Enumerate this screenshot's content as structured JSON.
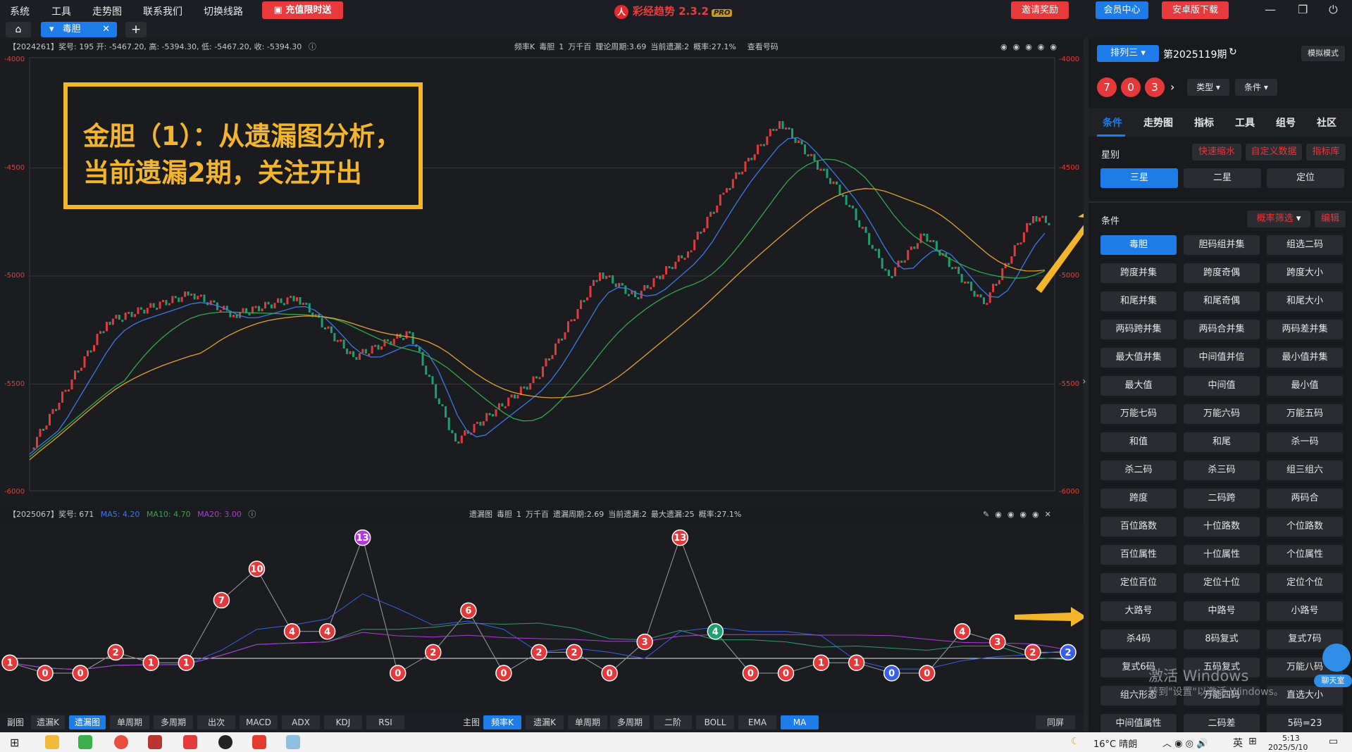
{
  "menu": {
    "items": [
      "系统",
      "工具",
      "走势图",
      "联系我们",
      "切换线路"
    ],
    "promo": "充值限时送"
  },
  "app": {
    "name": "彩经趋势 2.3.2",
    "badge": "PRO"
  },
  "top_buttons": {
    "invite": "邀请奖励",
    "member": "会员中心",
    "android": "安卓版下载"
  },
  "tab": {
    "label": "毒胆"
  },
  "main_chart": {
    "info_left": "【2024261】奖号: 195  开: -5467.20, 高: -5394.30, 低: -5467.20, 收: -5394.30",
    "info_right": [
      "频率K",
      "毒胆",
      "1",
      "万千百",
      "理论周期:3.69",
      "当前遗漏:2",
      "概率:27.1%",
      "查看号码"
    ],
    "y_ticks": [
      "-4000",
      "-4500",
      "-5000",
      "-5500",
      "-6000"
    ]
  },
  "annotation": {
    "line1": "金胆（1）：从遗漏图分析，",
    "line2": "当前遗漏2期，关注开出"
  },
  "omission_chart": {
    "info_left": "【2025067】奖号: 671",
    "ma5": "MA5: 4.20",
    "ma10": "MA10: 4.70",
    "ma20": "MA20: 3.00",
    "info_right": [
      "遗漏图",
      "毒胆",
      "1",
      "万千百",
      "遗漏周期:2.69",
      "当前遗漏:2",
      "最大遗漏:25",
      "概率:27.1%"
    ],
    "points": [
      1,
      0,
      0,
      2,
      1,
      1,
      7,
      10,
      4,
      4,
      13,
      0,
      2,
      6,
      0,
      2,
      2,
      0,
      3,
      13,
      4,
      0,
      0,
      1,
      1,
      0,
      0,
      4,
      3,
      2,
      2
    ]
  },
  "bottom_toolbar": {
    "left_label": "副图",
    "left": [
      "遗漏K",
      "遗漏图",
      "单周期",
      "多周期",
      "出次",
      "MACD",
      "ADX",
      "KDJ",
      "RSI"
    ],
    "mid_label": "主图",
    "mid": [
      "频率K",
      "遗漏K",
      "单周期",
      "多周期",
      "二阶",
      "BOLL",
      "EMA",
      "MA"
    ],
    "right": "同屏"
  },
  "right_panel": {
    "lottery": "排列三",
    "issue": "第2025119期",
    "mode": "模拟模式",
    "balls": [
      "7",
      "0",
      "3"
    ],
    "type_label": "类型",
    "cond_label": "条件",
    "tabs": [
      "条件",
      "走势图",
      "指标",
      "工具",
      "组号",
      "社区"
    ],
    "star_label": "星别",
    "links": [
      "快速缩水",
      "自定义数据",
      "指标库"
    ],
    "stars": [
      "三星",
      "二星",
      "定位"
    ],
    "cond_title": "条件",
    "filter": "概率筛选",
    "edit": "编辑",
    "grid": [
      "毒胆",
      "胆码组并集",
      "组选二码",
      "跨度并集",
      "跨度奇偶",
      "跨度大小",
      "和尾并集",
      "和尾奇偶",
      "和尾大小",
      "两码跨并集",
      "两码合并集",
      "两码差并集",
      "最大值并集",
      "中间值并信",
      "最小值并集",
      "最大值",
      "中间值",
      "最小值",
      "万能七码",
      "万能六码",
      "万能五码",
      "和值",
      "和尾",
      "杀一码",
      "杀二码",
      "杀三码",
      "组三组六",
      "跨度",
      "二码跨",
      "两码合",
      "百位路数",
      "十位路数",
      "个位路数",
      "百位属性",
      "十位属性",
      "个位属性",
      "定位百位",
      "定位十位",
      "定位个位",
      "大路号",
      "中路号",
      "小路号",
      "杀4码",
      "8码复式",
      "复式7码",
      "复式6码",
      "五码复式",
      "万能八码",
      "组六形态",
      "万能四码",
      "直选大小",
      "中间值属性",
      "二码差",
      "5码=23"
    ],
    "chat": "聊天室"
  },
  "watermark": {
    "line1": "激活 Windows",
    "line2": "转到\"设置\"以激活 Windows。"
  },
  "taskbar": {
    "weather": "16°C  晴朗",
    "ime": "英",
    "time": "5:13",
    "date": "2025/5/10"
  }
}
